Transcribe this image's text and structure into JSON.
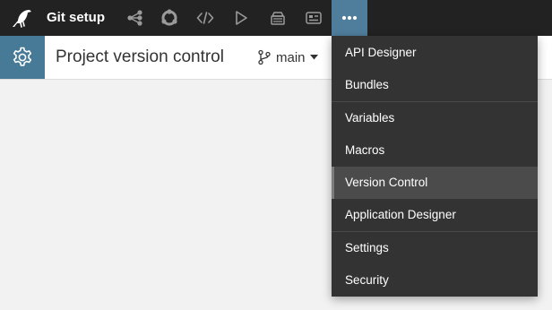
{
  "app": {
    "project_name": "Git setup"
  },
  "nav_icons": [
    {
      "name": "flow-icon"
    },
    {
      "name": "lab-icon"
    },
    {
      "name": "code-icon"
    },
    {
      "name": "run-icon"
    },
    {
      "name": "deploy-icon"
    },
    {
      "name": "dashboard-icon"
    },
    {
      "name": "more-icon"
    }
  ],
  "subheader": {
    "title": "Project version control",
    "branch": "main"
  },
  "menu": {
    "items": [
      "API Designer",
      "Bundles",
      "Variables",
      "Macros",
      "Version Control",
      "Application Designer",
      "Settings",
      "Security"
    ],
    "active": "Version Control"
  },
  "colors": {
    "topbar": "#222222",
    "accent": "#467a96",
    "menu_bg": "#333333",
    "menu_active": "#4b4b4b",
    "page_bg": "#f2f2f2"
  }
}
